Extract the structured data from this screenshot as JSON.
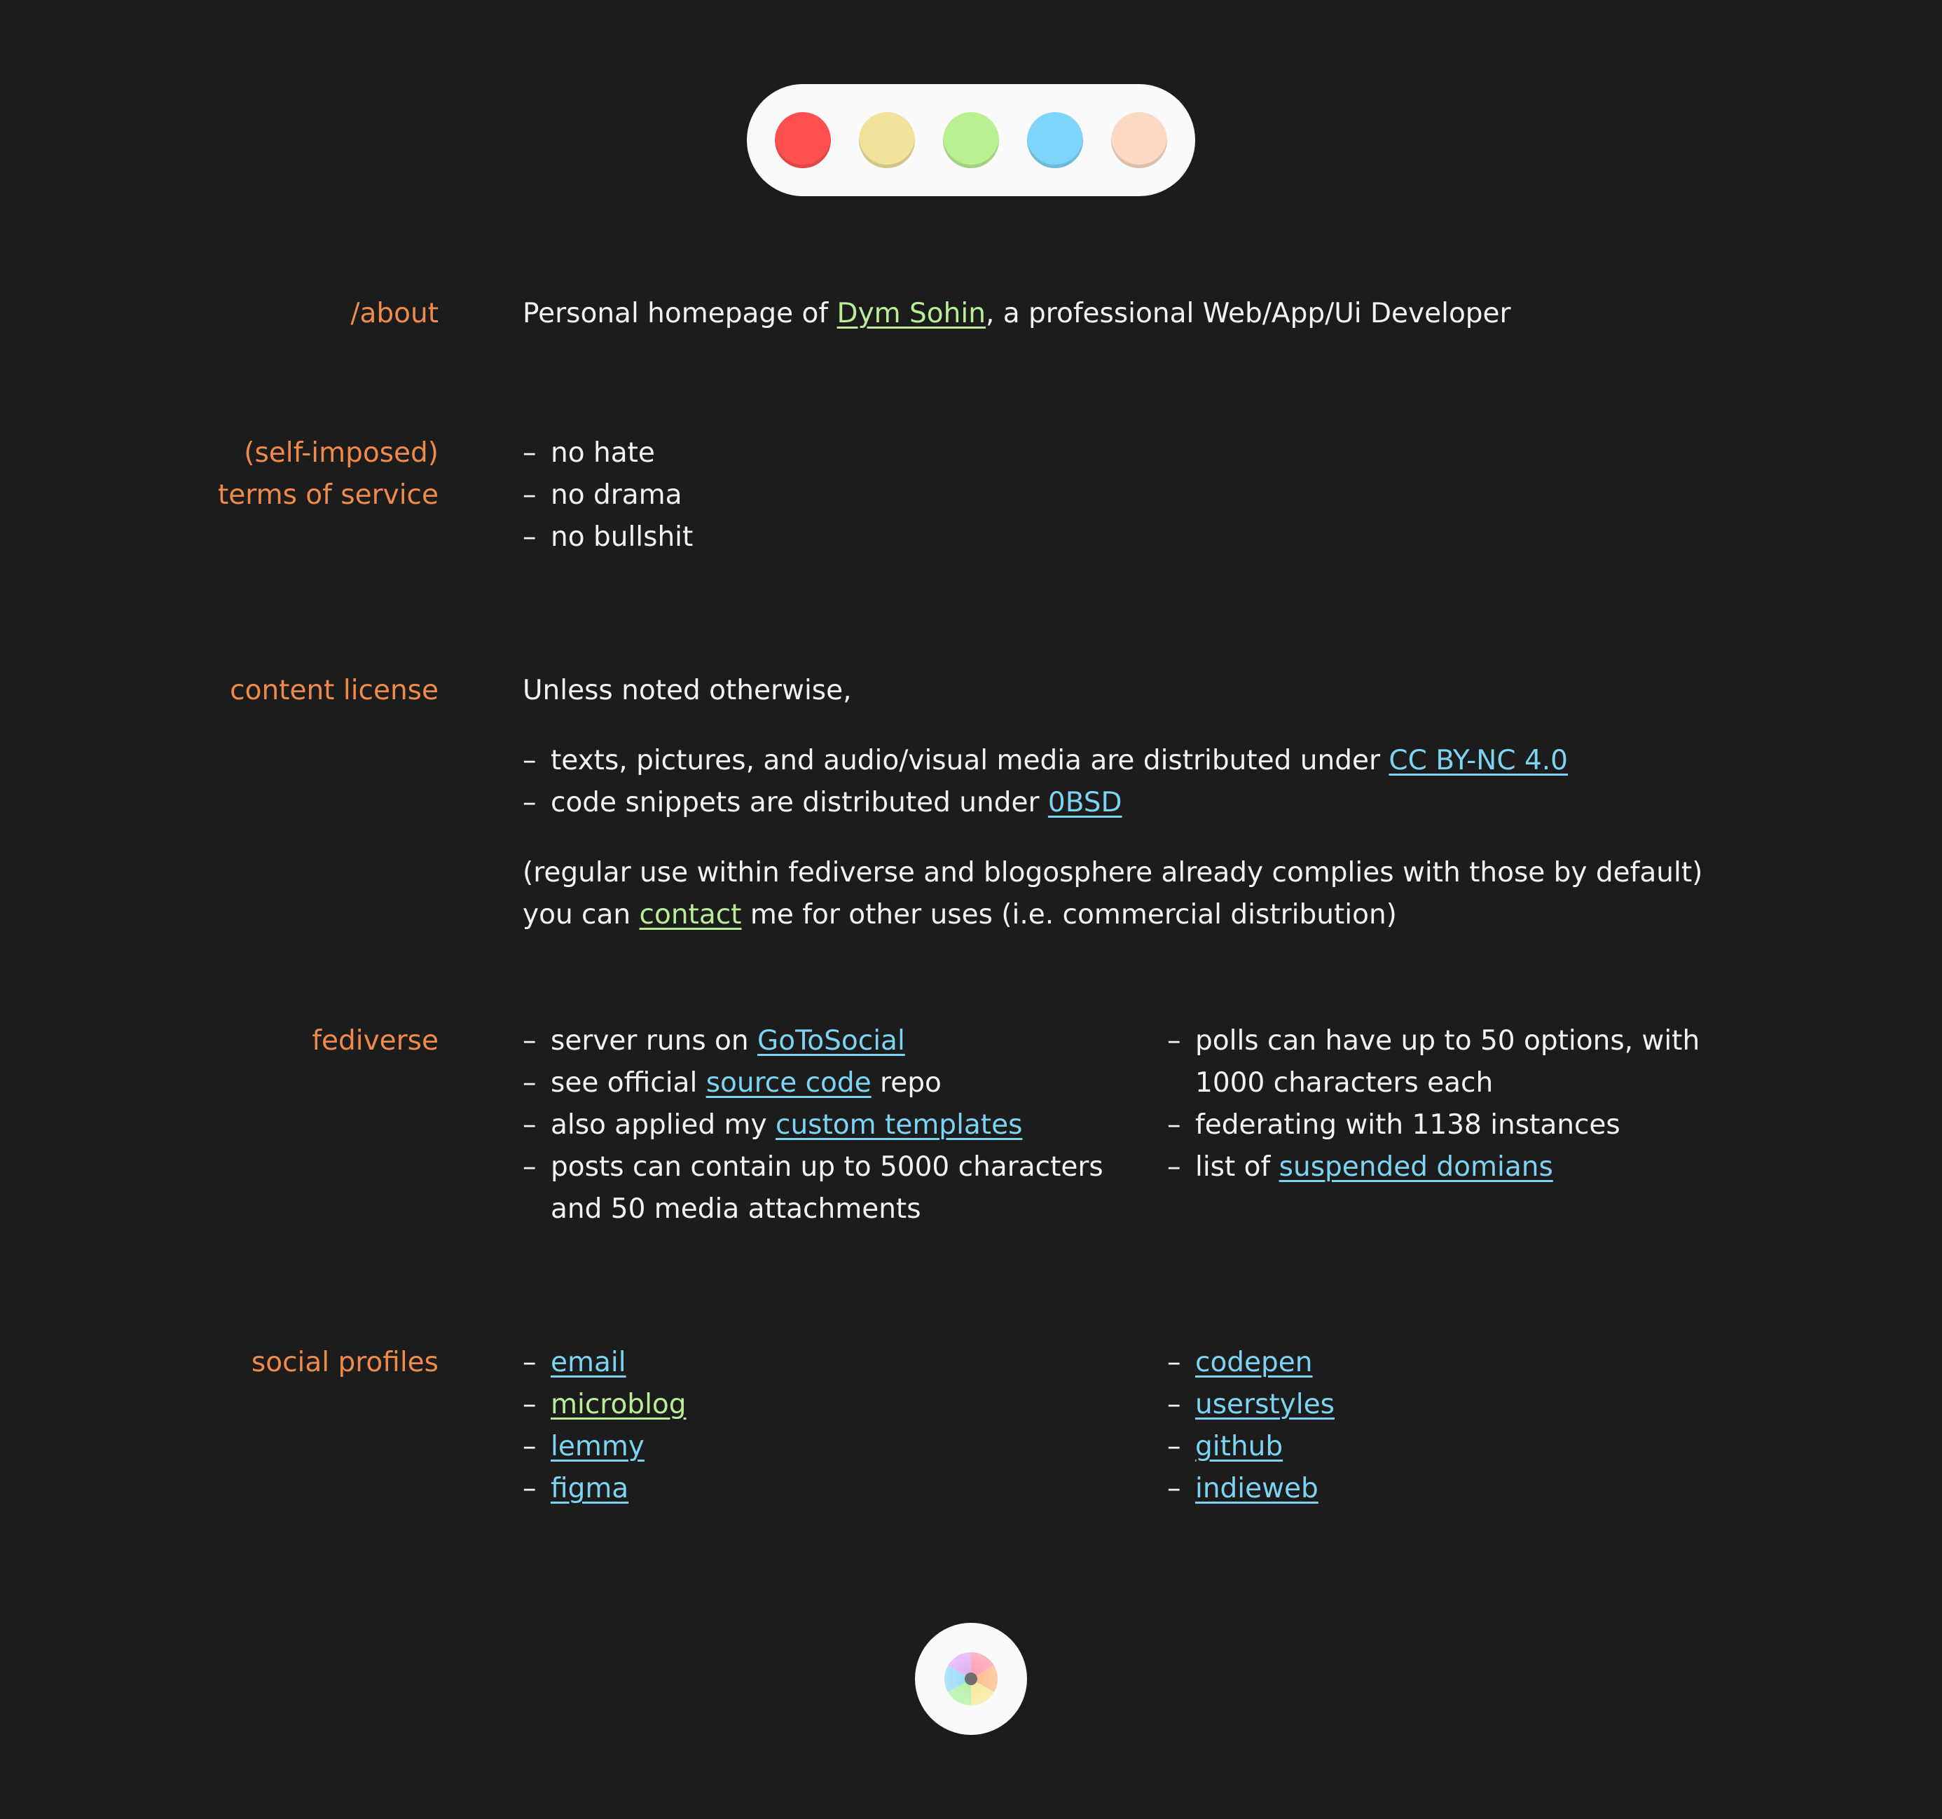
{
  "theme_dots": [
    {
      "name": "red",
      "color": "#ff5050"
    },
    {
      "name": "yellow",
      "color": "#f0e19b"
    },
    {
      "name": "green",
      "color": "#b9f092"
    },
    {
      "name": "blue",
      "color": "#7ed4fa"
    },
    {
      "name": "peach",
      "color": "#fbd9c2"
    }
  ],
  "colors": {
    "background": "#1c1c1c",
    "text": "#f2f2f2",
    "label": "#ef8a4a",
    "link_blue": "#7dd3f2",
    "link_green": "#b8ee98"
  },
  "dash": "–",
  "about": {
    "label": "/about",
    "pre": "Personal homepage of ",
    "link": "Dym Sohin",
    "post": ", a professional Web/App/Ui Developer"
  },
  "tos": {
    "label_line1": "(self-imposed)",
    "label_line2": "terms of service",
    "items": [
      "no hate",
      "no drama",
      "no bullshit"
    ]
  },
  "license": {
    "label": "content license",
    "intro": "Unless noted otherwise,",
    "item1_pre": "texts, pictures, and audio/visual media are distributed under ",
    "item1_link": "CC BY-NC 4.0",
    "item2_pre": "code snippets are distributed under ",
    "item2_link": "0BSD",
    "note": "(regular use within fediverse and blogosphere already complies with those by default)",
    "contact_pre": "you can ",
    "contact_link": "contact",
    "contact_post": " me for other uses (i.e. commercial distribution)"
  },
  "fediverse": {
    "label": "fediverse",
    "left": {
      "item1_pre": "server runs on ",
      "item1_link": "GoToSocial",
      "item2_pre": "see official ",
      "item2_link": "source code",
      "item2_post": " repo",
      "item3_pre": "also applied my ",
      "item3_link": "custom templates",
      "item4_line1": "posts can contain up to 5000 characters",
      "item4_line2": "and 50 media attachments"
    },
    "right": {
      "item1_line1": "polls can have up to 50 options, with",
      "item1_line2": "1000 characters each",
      "item2": "federating with 1138 instances",
      "item3_pre": "list of ",
      "item3_link": "suspended domians"
    }
  },
  "social": {
    "label": "social profiles",
    "left": [
      "email",
      "microblog",
      "lemmy",
      "figma"
    ],
    "right": [
      "codepen",
      "userstyles",
      "github",
      "indieweb"
    ]
  },
  "footer": {
    "icon": "color-wheel-icon"
  }
}
